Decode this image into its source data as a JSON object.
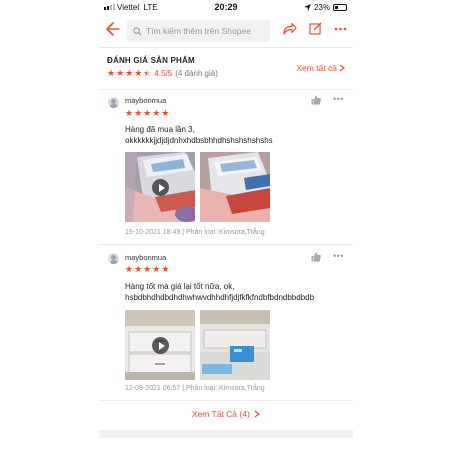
{
  "status_bar": {
    "carrier": "Viettel",
    "network": "LTE",
    "time": "20:29",
    "battery": "23%"
  },
  "topbar": {
    "search_placeholder": "Tìm kiếm thêm trên Shopee",
    "icons": [
      "back-arrow-icon",
      "search-icon",
      "share-icon",
      "edit-icon",
      "more-icon"
    ],
    "accent_color": "#ee4d2d"
  },
  "ratings": {
    "title": "ĐÁNH GIÁ SẢN PHẨM",
    "score": "4.5/5",
    "count": "(4 đánh giá)",
    "see_all": "Xem tất cả",
    "stars": 4.5
  },
  "reviews": [
    {
      "username": "maybonmua",
      "stars": 5,
      "text_line1": "Hàng đã mua lần 3,",
      "text_line2": "okkkkkkjjdjdjdnhxhdbsbhhdhshshshshshs",
      "meta": "19-10-2021 18:49 | Phân loại: Kimsora,Trắng"
    },
    {
      "username": "maybonmua",
      "stars": 5,
      "text_line1": "Hàng tốt mà giá lại tốt nữa, ok,",
      "text_line2": "hsbdbhdhdbdhdhwhwvdhhdhfjdjfkfkfndbfbdndbbdbdb",
      "meta": "12-09-2021 06:57 | Phân loại: Kimsora,Trắng"
    }
  ],
  "footer": {
    "see_all_label": "Xem Tất Cả (4)"
  }
}
